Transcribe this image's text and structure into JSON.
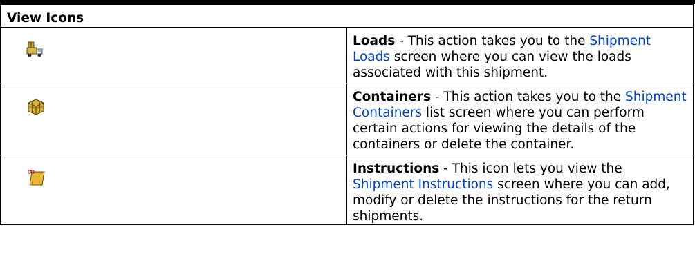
{
  "table": {
    "header": "View Icons",
    "rows": [
      {
        "icon": "loads-truck-icon",
        "term": "Loads",
        "pre": " - This action takes you to the ",
        "link": "Shipment Loads",
        "post": " screen where you can view the loads associated with this shipment."
      },
      {
        "icon": "containers-box-icon",
        "term": "Containers",
        "pre": " - This action takes you to the ",
        "link": "Shipment Containers",
        "post": " list screen where you can perform certain actions for viewing the details of the containers or delete the container."
      },
      {
        "icon": "instructions-note-icon",
        "term": "Instructions",
        "pre": " - This icon lets you view the ",
        "link": "Shipment Instructions",
        "post": " screen where you can add, modify or delete the instructions for the return shipments."
      }
    ]
  },
  "colors": {
    "link": "#0044cc",
    "rule": "#000000"
  }
}
